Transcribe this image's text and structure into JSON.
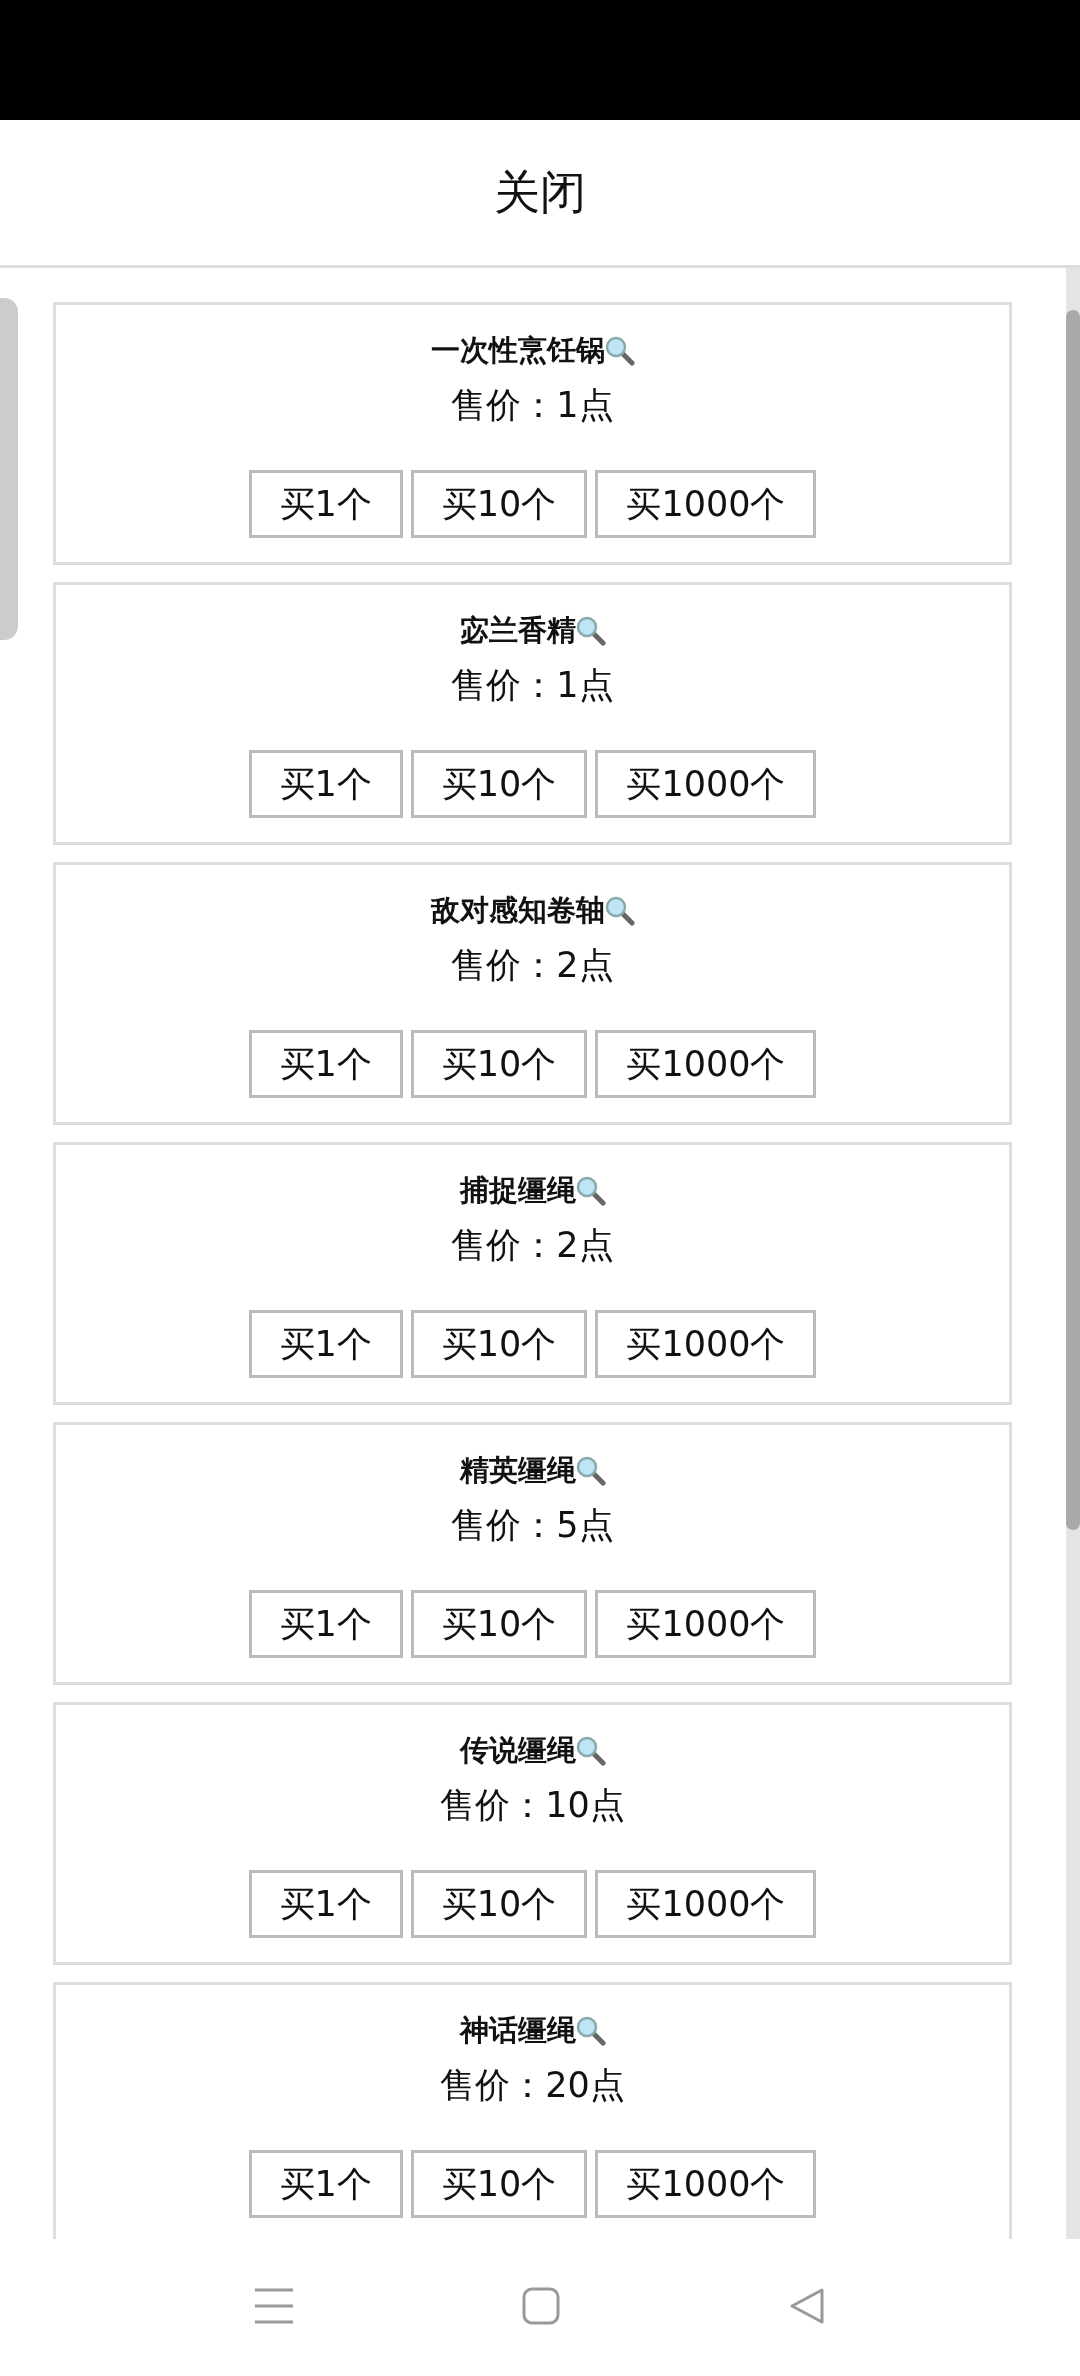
{
  "header": {
    "title": "关闭"
  },
  "items": [
    {
      "name": "一次性烹饪锅",
      "price": "售价：1点",
      "buttons": [
        "买1个",
        "买10个",
        "买1000个"
      ]
    },
    {
      "name": "宓兰香精",
      "price": "售价：1点",
      "buttons": [
        "买1个",
        "买10个",
        "买1000个"
      ]
    },
    {
      "name": "敌对感知卷轴",
      "price": "售价：2点",
      "buttons": [
        "买1个",
        "买10个",
        "买1000个"
      ]
    },
    {
      "name": "捕捉缰绳",
      "price": "售价：2点",
      "buttons": [
        "买1个",
        "买10个",
        "买1000个"
      ]
    },
    {
      "name": "精英缰绳",
      "price": "售价：5点",
      "buttons": [
        "买1个",
        "买10个",
        "买1000个"
      ]
    },
    {
      "name": "传说缰绳",
      "price": "售价：10点",
      "buttons": [
        "买1个",
        "买10个",
        "买1000个"
      ]
    },
    {
      "name": "神话缰绳",
      "price": "售价：20点",
      "buttons": [
        "买1个",
        "买10个",
        "买1000个"
      ]
    }
  ]
}
